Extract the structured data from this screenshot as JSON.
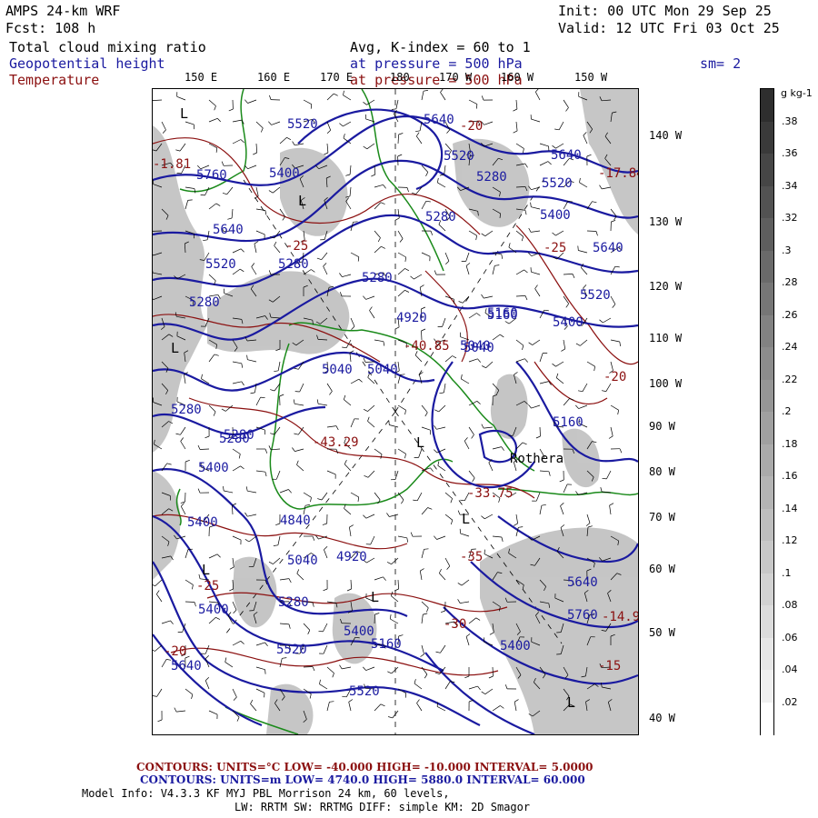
{
  "header": {
    "model": "AMPS 24-km WRF",
    "forecast": "Fcst:  108 h",
    "init": "Init: 00 UTC Mon 29 Sep 25",
    "valid": "Valid: 12 UTC Fri 03 Oct 25"
  },
  "fields": {
    "shaded": "Total cloud mixing ratio",
    "blue_contour": "Geopotential height",
    "red_contour": "Temperature",
    "avg_line": "Avg, K-index =  60 to   1",
    "pressure_blue": "at pressure =  500 hPa",
    "pressure_red": "at pressure = 500 hPa",
    "smoothing": "sm= 2"
  },
  "lon_labels": [
    "150 E",
    "160 E",
    "170 E",
    "180",
    "170 W",
    "160 W",
    "150 W"
  ],
  "lat_labels": [
    "140 W",
    "130 W",
    "120 W",
    "110 W",
    "100 W",
    "90 W",
    "80 W",
    "70 W",
    "60 W",
    "50 W",
    "40 W"
  ],
  "colorbar": {
    "units": "g kg-1",
    "labels": [
      ".38",
      ".36",
      ".34",
      ".32",
      ".3",
      ".28",
      ".26",
      ".24",
      ".22",
      ".2",
      ".18",
      ".16",
      ".14",
      ".12",
      ".1",
      ".08",
      ".06",
      ".04",
      ".02"
    ],
    "colors": [
      "#2e2e2e",
      "#3a3a3a",
      "#464646",
      "#525252",
      "#5e5e5e",
      "#6a6a6a",
      "#767676",
      "#828282",
      "#8c8c8c",
      "#969696",
      "#a0a0a0",
      "#aaaaaa",
      "#b4b4b4",
      "#bebebe",
      "#c8c8c8",
      "#d2d2d2",
      "#dcdcdc",
      "#e6e6e6",
      "#f0f0f0",
      "#ffffff"
    ]
  },
  "map_labels": {
    "height": [
      "5520",
      "5640",
      "5520",
      "5640",
      "5760",
      "5400",
      "5280",
      "5280",
      "5640",
      "5520",
      "5400",
      "5640",
      "5520",
      "5400",
      "5280",
      "5280",
      "5520",
      "5280",
      "5280",
      "5400",
      "5160",
      "5400",
      "5040",
      "4920",
      "4840",
      "5040",
      "5040",
      "5160",
      "5280",
      "5280",
      "5400",
      "5400",
      "5280",
      "5040",
      "4920",
      "5160",
      "5400",
      "5640",
      "5760",
      "5520",
      "5640",
      "5520",
      "5040",
      "5160"
    ],
    "temperature": [
      "-1.81",
      "-25",
      "-20",
      "-40.85",
      "-43.29",
      "-33.75",
      "-35",
      "-30",
      "-25",
      "-20",
      "-15",
      "-14.9",
      "-17.84",
      "-20",
      "-25"
    ],
    "lows": [
      "L",
      "L",
      "L",
      "L",
      "L",
      "L",
      "L",
      "L"
    ],
    "place": "Rothera"
  },
  "footer": {
    "red_contours": "CONTOURS:  UNITS=°C  LOW= -40.000       HIGH= -10.000       INTERVAL=   5.0000",
    "blue_contours": "CONTOURS:  UNITS=m  LOW=  4740.0       HIGH=  5880.0       INTERVAL=   60.000",
    "model_info": "Model Info: V4.3.3   KF      MYJ PBL  Morrison           24 km,    60 levels,",
    "model_info2": "LW: RRTM SW: RRTMG   DIFF: simple KM: 2D Smagor"
  },
  "colors": {
    "height_contour": "#1a1aa0",
    "temp_contour": "#8b1010",
    "coast": "#1a8a1a",
    "cloud": "#bcbcbc"
  }
}
